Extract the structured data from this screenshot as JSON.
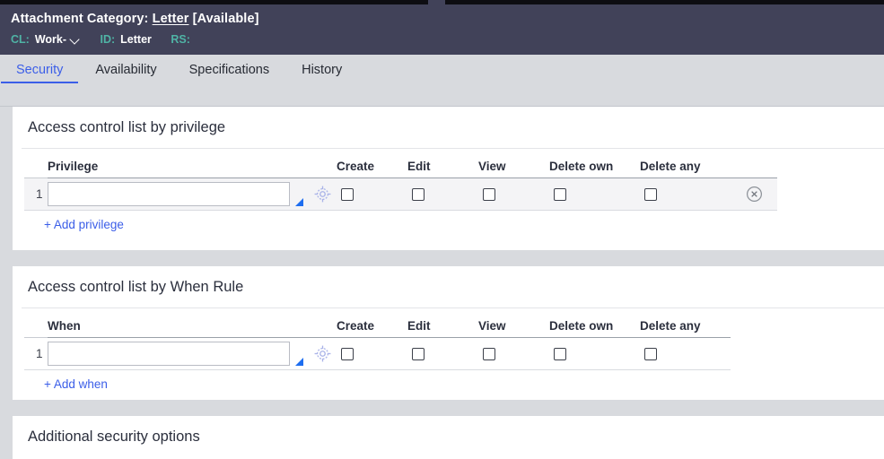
{
  "window": {
    "accent_dark": "#414259",
    "accent_blue": "#3b5ee8",
    "accent_teal": "#4fb3a5",
    "page_bg": "#d8dade"
  },
  "header": {
    "title_prefix": "Attachment Category:",
    "title_link": "Letter",
    "title_status": "[Available]",
    "meta": [
      {
        "label": "CL:",
        "value": "Work-",
        "has_chevron": true
      },
      {
        "label": "ID:",
        "value": "Letter",
        "has_chevron": false
      },
      {
        "label": "RS:",
        "value": "",
        "has_chevron": false
      }
    ]
  },
  "tabs": [
    {
      "label": "Security",
      "active": true
    },
    {
      "label": "Availability",
      "active": false
    },
    {
      "label": "Specifications",
      "active": false
    },
    {
      "label": "History",
      "active": false
    }
  ],
  "sections": {
    "privilege": {
      "title": "Access control list by privilege",
      "columns": [
        "Privilege",
        "Create",
        "Edit",
        "View",
        "Delete own",
        "Delete any"
      ],
      "rows": [
        {
          "index": "1",
          "value": "",
          "placeholder": "",
          "create": false,
          "edit": false,
          "view": false,
          "delete_own": false,
          "delete_any": false,
          "has_delete_button": true
        }
      ],
      "add_link": "+ Add privilege"
    },
    "when": {
      "title": "Access control list by When Rule",
      "columns": [
        "When",
        "Create",
        "Edit",
        "View",
        "Delete own",
        "Delete any"
      ],
      "rows": [
        {
          "index": "1",
          "value": "",
          "placeholder": "",
          "create": false,
          "edit": false,
          "view": false,
          "delete_own": false,
          "delete_any": false,
          "has_delete_button": false
        }
      ],
      "add_link": "+ Add when"
    },
    "extra": {
      "title": "Additional security options"
    }
  },
  "icons": {
    "picker": "crosshair-target-icon",
    "remove": "remove-row-icon",
    "chevron": "chevron-down-icon",
    "resize": "resize-grip-icon"
  }
}
